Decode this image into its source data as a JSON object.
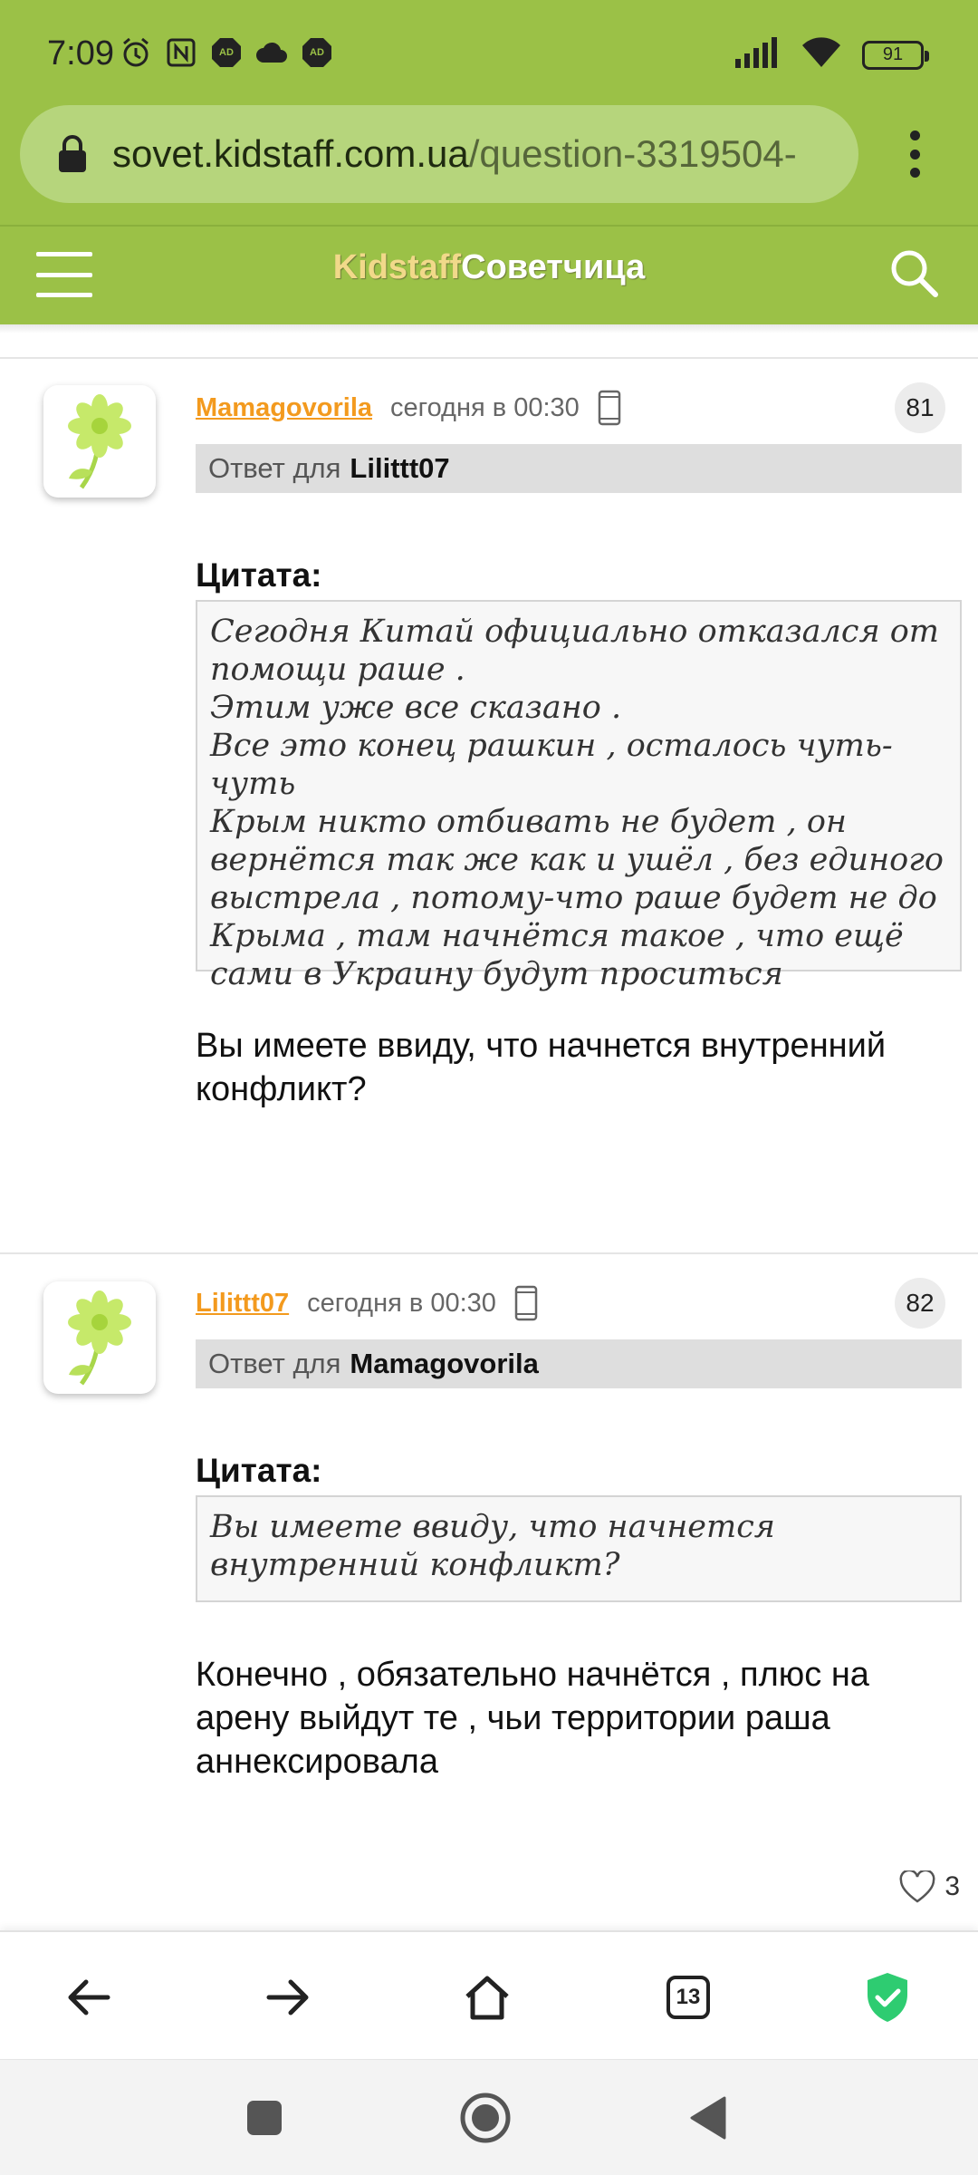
{
  "status_bar": {
    "time": "7:09",
    "battery": "91",
    "icons_left": [
      "alarm-icon",
      "nfc-icon",
      "adblock-icon",
      "cloud-icon",
      "adblock-icon"
    ],
    "icons_right": [
      "signal-icon",
      "wifi-icon",
      "battery-icon"
    ]
  },
  "browser": {
    "url_host": "sovet.kidstaff.com.ua",
    "url_path": "/question-3319504-"
  },
  "site": {
    "brand_part1": "Kidstaff",
    "brand_part2": "Советчица"
  },
  "posts": [
    {
      "author": "Mamagovorila",
      "time": "сегодня в 00:30",
      "number": "81",
      "reply_prefix": "Ответ для",
      "reply_to": "Lilittt07",
      "quote_label": "Цитата:",
      "quote": "Сегодня Китай официально отказался от помощи раше .\nЭтим уже все сказано .\nВсе это конец рашкин , осталось чуть-чуть\nКрым никто отбивать не будет , он вернётся так же как и ушёл , без единого выстрела , потому-что раше будет не до Крыма , там начнётся такое , что ещё сами в Украину будут проситься",
      "body": "Вы имеете ввиду, что начнется внутренний конфликт?"
    },
    {
      "author": "Lilittt07",
      "time": "сегодня в 00:30",
      "number": "82",
      "reply_prefix": "Ответ для",
      "reply_to": "Mamagovorila",
      "quote_label": "Цитата:",
      "quote": "Вы имеете ввиду, что начнется внутренний конфликт?",
      "body": "Конечно , обязательно начнётся , плюс на арену выйдут те , чьи территории раша аннексировала",
      "likes": "3"
    }
  ],
  "toolbar": {
    "tabs_count": "13"
  },
  "colors": {
    "brand_green": "#9bc147",
    "author_orange": "#f39a1e",
    "shield_green": "#2ecc71"
  }
}
